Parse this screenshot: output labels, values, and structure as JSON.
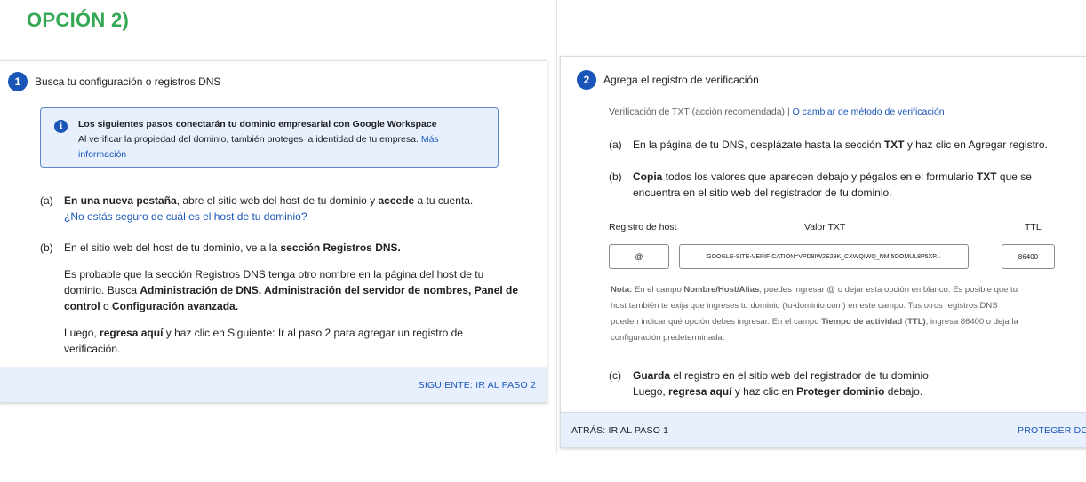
{
  "heading": "OPCIÓN 2)",
  "step1": {
    "number": "1",
    "title": "Busca tu configuración o registros DNS",
    "info": {
      "icon": "info-icon",
      "title": "Los siguientes pasos conectarán tu dominio empresarial con Google Workspace",
      "body": "Al verificar la propiedad del dominio, también proteges la identidad de tu empresa.",
      "link_part1": "Más",
      "link_part2": "información"
    },
    "a": {
      "letter": "(a)",
      "t1": "En una nueva pestaña",
      "t2": ", abre el sitio web del host de tu dominio y ",
      "t3": "accede",
      "t4": " a tu cuenta.",
      "link": "¿No estás seguro de cuál es el host de tu dominio?"
    },
    "b": {
      "letter": "(b)",
      "t1": "En el sitio web del host de tu dominio, ve a la ",
      "t2": "sección Registros DNS.",
      "p1_l1": "Es probable que la sección Registros DNS tenga otro nombre en la página del host de tu",
      "p1_l2a": "dominio. Busca ",
      "p1_l2b": "Administración de DNS, Administración del servidor de nombres, Panel de",
      "p1_l3a": "control",
      "p1_l3b": " o ",
      "p1_l3c": "Configuración avanzada.",
      "p2_l1a": "Luego, ",
      "p2_l1b": "regresa aquí",
      "p2_l1c": " y haz clic en Siguiente: Ir al paso 2 para agregar un registro de",
      "p2_l2": "verificación."
    },
    "footer_button": "SIGUIENTE: IR AL PASO 2"
  },
  "step2": {
    "number": "2",
    "title": "Agrega el registro de verificación",
    "method": "Verificación de TXT (acción recomendada)",
    "separator": "|",
    "change_link": "O cambiar de método de verificación",
    "a": {
      "letter": "(a)",
      "t1": "En la página de tu DNS, desplázate hasta la sección ",
      "t2": "TXT",
      "t3": " y haz clic en Agregar registro."
    },
    "b": {
      "letter": "(b)",
      "t1": "Copia",
      "t2": " todos los valores que aparecen debajo y pégalos en el formulario ",
      "t3": "TXT",
      "t4": " que se",
      "l2": "encuentra en el sitio web del registrador de tu dominio."
    },
    "table": {
      "headers": [
        "Registro de host",
        "Valor TXT",
        "TTL"
      ],
      "host_value": "@",
      "txt_value": "GOOGLE-SITE-VERIFICATION=VPD8IW2E29K_CXWQIWQ_NMI5OOMUL8P5XP...",
      "ttl_value": "86400"
    },
    "note": {
      "n1": "Nota:",
      "n2": " En el campo ",
      "n3": "Nombre/Host/Alias",
      "n4": ", puedes ingresar @ o dejar esta opción en blanco. Es posible que tu",
      "l2": "host también te exija que ingreses tu dominio (tu-dominio.com) en este campo. Tus otros registros DNS",
      "l3a": "pueden indicar qué opción debes ingresar. En el campo ",
      "l3b": "Tiempo de actividad (TTL)",
      "l3c": ", ingresa 86400 o deja la",
      "l4": "configuración predeterminada."
    },
    "c": {
      "letter": "(c)",
      "t1": "Guarda",
      "t2": " el registro en el sitio web del registrador de tu dominio.",
      "l2a": "Luego, ",
      "l2b": "regresa aquí",
      "l2c": " y haz clic en ",
      "l2d": "Proteger dominio",
      "l2e": " debajo."
    },
    "back_button": "ATRÁS: IR AL PASO 1",
    "protect_button": "PROTEGER DOMINIO"
  }
}
